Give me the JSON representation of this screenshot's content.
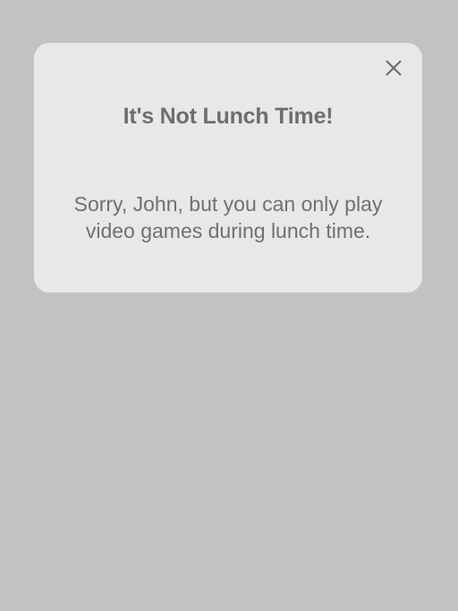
{
  "dialog": {
    "title": "It's Not Lunch Time!",
    "message": "Sorry, John, but you can only play video games during lunch time.",
    "close_icon": "close-icon"
  },
  "colors": {
    "backdrop": "#c2c2c2",
    "dialog_background": "#e8e8e8",
    "text": "#6e6e6e"
  }
}
